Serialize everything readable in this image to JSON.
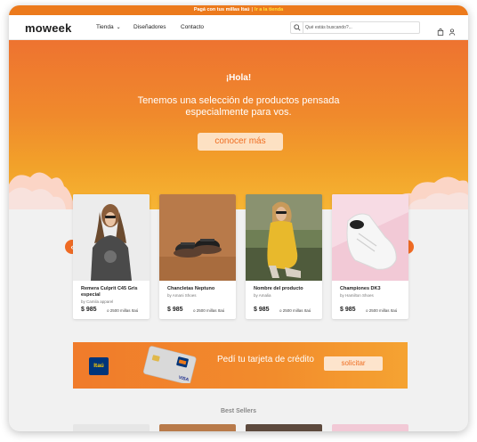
{
  "promo": {
    "text": "Pagá con tus millas Itaú",
    "separator": "|",
    "link": "Ir a la tienda"
  },
  "nav": {
    "logo": "moweek",
    "links": [
      "Tienda",
      "Diseñadores",
      "Contacto"
    ],
    "search_placeholder": "Qué estás buscando?...",
    "icons": [
      "search-icon",
      "shopping-bag-icon",
      "user-icon"
    ]
  },
  "hero": {
    "greeting": "¡Hola!",
    "text": "Tenemos una selección de productos pensada especialmente para vos.",
    "button": "conocer más"
  },
  "carousel": {
    "prev": "‹",
    "next": "›",
    "products": [
      {
        "name": "Remera Culprit C45 Gris especial",
        "brand": "by Camila apparel",
        "price": "$ 985",
        "miles": "o 2500 millas Itaú"
      },
      {
        "name": "Chancletas Neptuno",
        "brand": "by Amani Shoes",
        "price": "$ 985",
        "miles": "o 2500 millas Itaú"
      },
      {
        "name": "Nombre del producto",
        "brand": "by Amalia",
        "price": "$ 985",
        "miles": "o 2500 millas Itaú"
      },
      {
        "name": "Championes DK3",
        "brand": "by Hamilton Shoes",
        "price": "$ 985",
        "miles": "o 2500 millas Itaú"
      }
    ]
  },
  "itau_banner": {
    "logo": "Itaú",
    "card_brand": "VISA",
    "text": "Pedí tu tarjeta de crédito",
    "button": "solicitar"
  },
  "section_title": "Best Sellers",
  "colors": {
    "accent": "#ef6b24",
    "promo_bar": "#ec7a1c",
    "itau_blue": "#00357a",
    "itau_yellow": "#ffcc00"
  }
}
